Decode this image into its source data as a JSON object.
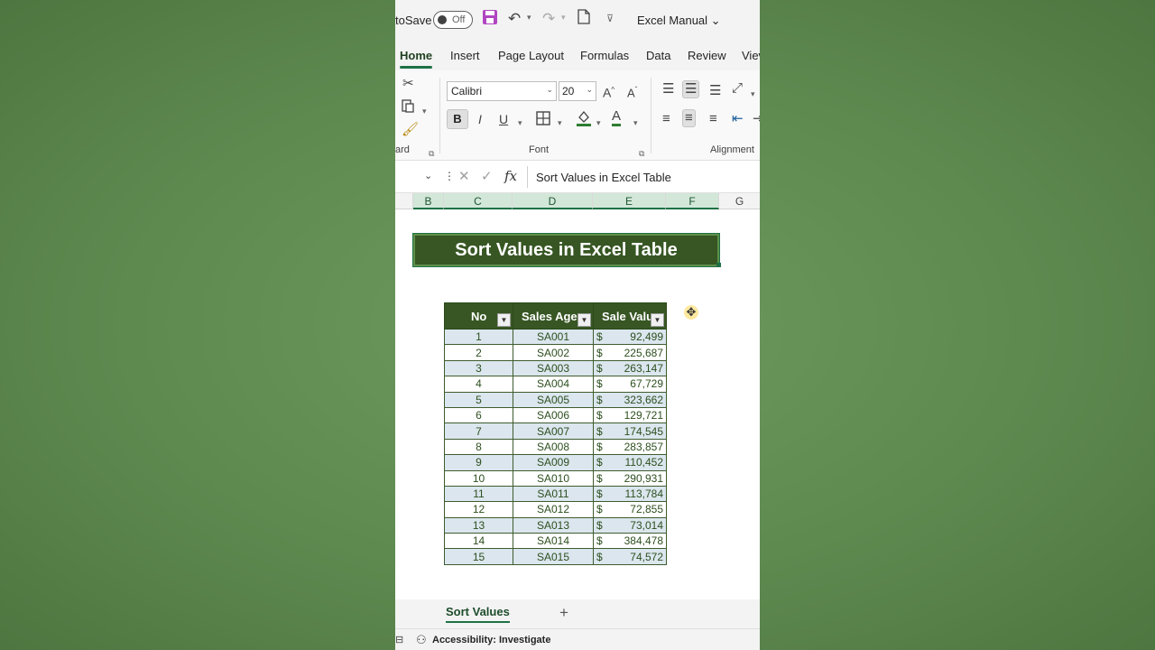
{
  "titlebar": {
    "autosave_label": "toSave",
    "autosave_state": "Off",
    "doc_title": "Excel Manual",
    "icons": [
      "save-icon",
      "undo-icon",
      "redo-icon",
      "new-file-icon",
      "customize-icon"
    ]
  },
  "tabs": [
    {
      "label": "Home",
      "active": true
    },
    {
      "label": "Insert"
    },
    {
      "label": "Page Layout"
    },
    {
      "label": "Formulas"
    },
    {
      "label": "Data"
    },
    {
      "label": "Review"
    },
    {
      "label": "Viev"
    }
  ],
  "ribbon": {
    "font_name": "Calibri",
    "font_size": "20",
    "bold_label": "B",
    "italic_label": "I",
    "underline_label": "U",
    "clipboard_label": "ard",
    "font_group_label": "Font",
    "alignment_group_label": "Alignment"
  },
  "formula_bar": {
    "fx_label": "fx",
    "content": "Sort Values in Excel Table"
  },
  "columns": [
    "B",
    "C",
    "D",
    "E",
    "F",
    "G"
  ],
  "banner_title": "Sort Values in Excel Table",
  "table": {
    "headers": [
      "No",
      "Sales Agen",
      "Sale Valu"
    ],
    "currency": "$",
    "rows": [
      {
        "no": "1",
        "agent": "SA001",
        "value": "92,499"
      },
      {
        "no": "2",
        "agent": "SA002",
        "value": "225,687"
      },
      {
        "no": "3",
        "agent": "SA003",
        "value": "263,147"
      },
      {
        "no": "4",
        "agent": "SA004",
        "value": "67,729"
      },
      {
        "no": "5",
        "agent": "SA005",
        "value": "323,662"
      },
      {
        "no": "6",
        "agent": "SA006",
        "value": "129,721"
      },
      {
        "no": "7",
        "agent": "SA007",
        "value": "174,545"
      },
      {
        "no": "8",
        "agent": "SA008",
        "value": "283,857"
      },
      {
        "no": "9",
        "agent": "SA009",
        "value": "110,452"
      },
      {
        "no": "10",
        "agent": "SA010",
        "value": "290,931"
      },
      {
        "no": "11",
        "agent": "SA011",
        "value": "113,784"
      },
      {
        "no": "12",
        "agent": "SA012",
        "value": "72,855"
      },
      {
        "no": "13",
        "agent": "SA013",
        "value": "73,014"
      },
      {
        "no": "14",
        "agent": "SA014",
        "value": "384,478"
      },
      {
        "no": "15",
        "agent": "SA015",
        "value": "74,572"
      }
    ]
  },
  "sheet_tabs": [
    {
      "label": "Sort Values",
      "active": true
    }
  ],
  "add_sheet_label": "+",
  "status": {
    "accessibility": "Accessibility: Investigate"
  },
  "colors": {
    "header_green": "#375623",
    "accent_green": "#1e7145",
    "band_blue": "#dbe6ee",
    "background_green": "#5e8a50"
  }
}
